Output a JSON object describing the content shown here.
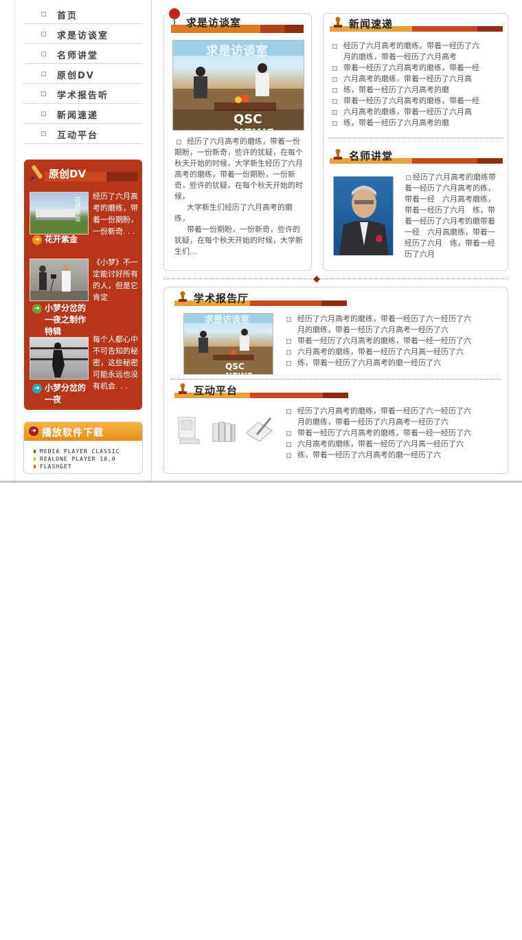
{
  "nav": {
    "items": [
      {
        "label": "首页"
      },
      {
        "label": "求是访谈室"
      },
      {
        "label": "名师讲堂"
      },
      {
        "label": "原创DV"
      },
      {
        "label": "学术报告听"
      },
      {
        "label": "新闻速递"
      },
      {
        "label": "互动平台"
      }
    ]
  },
  "dv": {
    "title": "原创DV",
    "items": [
      {
        "text": "经历了六月高考的磨练，带着一份期盼，一份新奇. . .",
        "caption": "花开紫金",
        "thumb_text": "花开紫金"
      },
      {
        "text": "《小梦》不一定能讨好所有的人，但是它肯定",
        "caption": "小梦分岔的一夜之制作特辑"
      },
      {
        "text": "每个人都心中不可告知的秘密，这些秘密可能永远也没有机会. . .",
        "caption": "小梦分岔的一夜"
      }
    ]
  },
  "download": {
    "title": "播放软件下载",
    "items": [
      "MEDIA PLAYER CLASSIC",
      "REALONE PLAYER 10.0",
      "FLASHGET"
    ],
    "colors": [
      "#3a8a2a",
      "#d9c21a",
      "#d16a1a"
    ]
  },
  "interview": {
    "title": "求是访谈室",
    "photo_banner": "求是访谈室",
    "photo_logo": "QSC NEWS",
    "paragraph1": "经历了六月高考的磨练，带着一份期盼，一份新奇，些许的犹疑，在每个秋天开始的时候，大学新生经历了六月高考的磨练，带着一份期盼，一份新奇，些许的犹疑，在每个秋天开始的时候，",
    "paragraph2": "大学新生们经历了六月高考的磨练，",
    "paragraph3": "带着一份期盼，一份新奇，些许的犹疑，在每个秋天开始的时候，大学新生们…"
  },
  "news": {
    "title": "新闻速递",
    "rows": [
      {
        "bullet": true,
        "text": "经历了六月高考的磨练，带着一经历了六"
      },
      {
        "bullet": false,
        "text": "月的磨练，带着一经历了六月高考"
      },
      {
        "bullet": true,
        "text": "带着一经历了六月高考的磨练，带着一经"
      },
      {
        "bullet": true,
        "text": "六月高考的磨练，带着一经历了六月高"
      },
      {
        "bullet": true,
        "text": "练，带着一经历了六月高考的磨"
      },
      {
        "bullet": true,
        "text": "带着一经历了六月高考的磨练，带着一经"
      },
      {
        "bullet": true,
        "text": "六月高考的磨练，带着一经历了六月高"
      },
      {
        "bullet": true,
        "text": "练，带着一经历了六月高考的磨"
      }
    ]
  },
  "teacher": {
    "title": "名师讲堂",
    "text": "经历了六月高考的磨练带着一经历了六月高考的练，带着一经　六月高考磨练，带着一经历了六月　练，带着一经历了六月考的磨带着一经　六月高磨练，带着一经历了六月　练，带着一经历了六月"
  },
  "report": {
    "title": "学术报告厅",
    "photo_logo": "QSC NEWS",
    "photo_banner": "求是访谈室",
    "rows": [
      {
        "bullet": true,
        "text": "经历了六月高考的磨练，带着一经历了六一经历了六"
      },
      {
        "bullet": false,
        "text": "月的磨练，带着一经历了六月高考一经历了六"
      },
      {
        "bullet": true,
        "text": "带着一经历了六月高考的磨练，带着一经一经历了六"
      },
      {
        "bullet": true,
        "text": "六月高考的磨练，带着一经历了六月高一经历了六"
      },
      {
        "bullet": true,
        "text": "练，带着一经历了六月高考的磨一经历了六"
      }
    ]
  },
  "interactive": {
    "title": "互动平台",
    "rows": [
      {
        "bullet": true,
        "text": "经历了六月高考的磨练，带着一经历了六一经历了六"
      },
      {
        "bullet": false,
        "text": "月的磨练，带着一经历了六月高考一经历了六"
      },
      {
        "bullet": true,
        "text": "带着一经历了六月高考的磨练，带着一经一经历了六"
      },
      {
        "bullet": true,
        "text": "六月高考的磨练，带着一经历了六月高一经历了六"
      },
      {
        "bullet": true,
        "text": "练，带着一经历了六月高考的磨一经历了六"
      }
    ]
  },
  "colors": {
    "accent_red": "#b53619",
    "title_bar_orange": "#e07a22",
    "title_bar_dark": "#8e2b10",
    "download_orange": "#ef9c2c"
  }
}
